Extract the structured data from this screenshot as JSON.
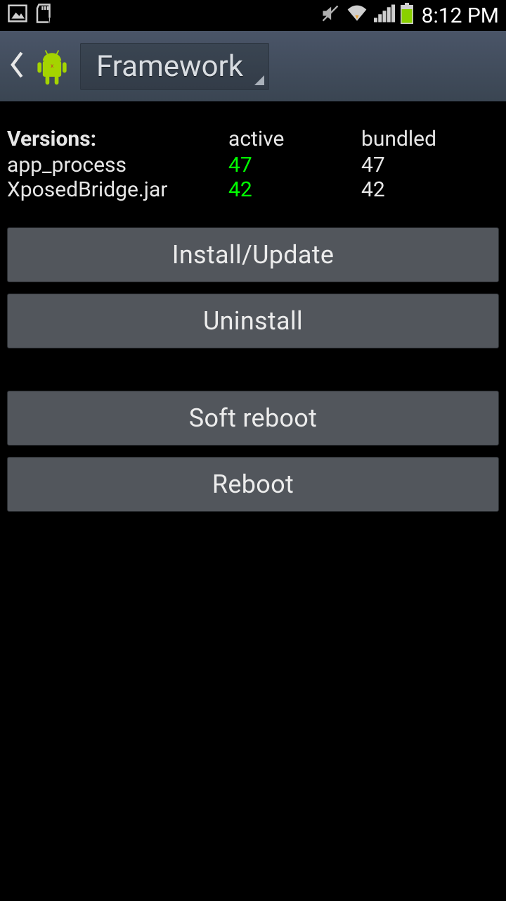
{
  "statusbar": {
    "clock": "8:12 PM"
  },
  "actionbar": {
    "spinner_label": "Framework"
  },
  "versions": {
    "heading": "Versions:",
    "col_active": "active",
    "col_bundled": "bundled",
    "rows": [
      {
        "name": "app_process",
        "active": "47",
        "bundled": "47"
      },
      {
        "name": "XposedBridge.jar",
        "active": "42",
        "bundled": "42"
      }
    ]
  },
  "buttons": {
    "install": "Install/Update",
    "uninstall": "Uninstall",
    "softreboot": "Soft reboot",
    "reboot": "Reboot"
  }
}
